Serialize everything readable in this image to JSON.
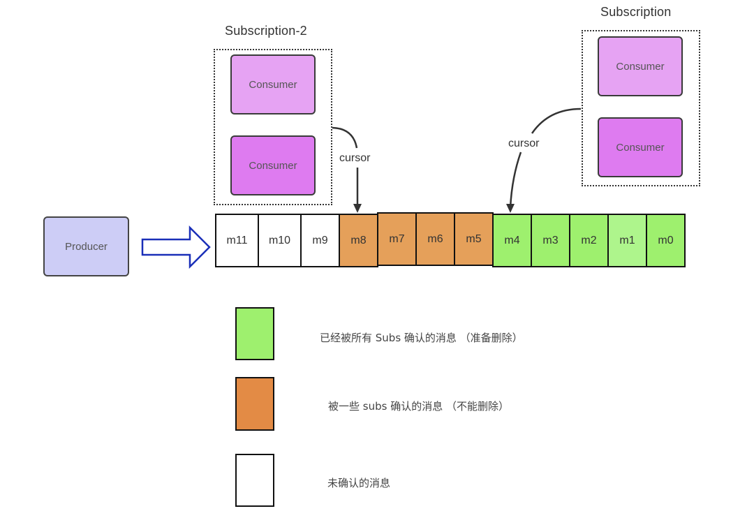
{
  "subscriptions": [
    {
      "title": "Subscription-2",
      "consumers": [
        {
          "label": "Consumer",
          "color": "#e6a3f3"
        },
        {
          "label": "Consumer",
          "color": "#de7bf0"
        }
      ],
      "cursor_label": "cursor",
      "cursor_points_to": "m8"
    },
    {
      "title": "Subscription",
      "consumers": [
        {
          "label": "Consumer",
          "color": "#e6a3f3"
        },
        {
          "label": "Consumer",
          "color": "#de7bf0"
        }
      ],
      "cursor_label": "cursor",
      "cursor_points_to": "m4"
    }
  ],
  "producer": {
    "label": "Producer",
    "color": "#cdcdf6"
  },
  "arrow_color": "#1a2fb8",
  "messages": [
    {
      "label": "m11",
      "state": "unacked"
    },
    {
      "label": "m10",
      "state": "unacked"
    },
    {
      "label": "m9",
      "state": "unacked"
    },
    {
      "label": "m8",
      "state": "partial"
    },
    {
      "label": "m7",
      "state": "partial"
    },
    {
      "label": "m6",
      "state": "partial"
    },
    {
      "label": "m5",
      "state": "partial"
    },
    {
      "label": "m4",
      "state": "acked"
    },
    {
      "label": "m3",
      "state": "acked"
    },
    {
      "label": "m2",
      "state": "acked"
    },
    {
      "label": "m1",
      "state": "acked-light"
    },
    {
      "label": "m0",
      "state": "acked"
    }
  ],
  "state_colors": {
    "unacked": "#ffffff",
    "partial": "#e5a05a",
    "acked": "#9ef06e",
    "acked-light": "#aef58c"
  },
  "legend": [
    {
      "color": "#9ef06e",
      "text": "已经被所有 Subs 确认的消息 （准备删除）"
    },
    {
      "color": "#e38b45",
      "text": "被一些 subs 确认的消息 （不能删除）"
    },
    {
      "color": "#ffffff",
      "text": "未确认的消息"
    }
  ]
}
